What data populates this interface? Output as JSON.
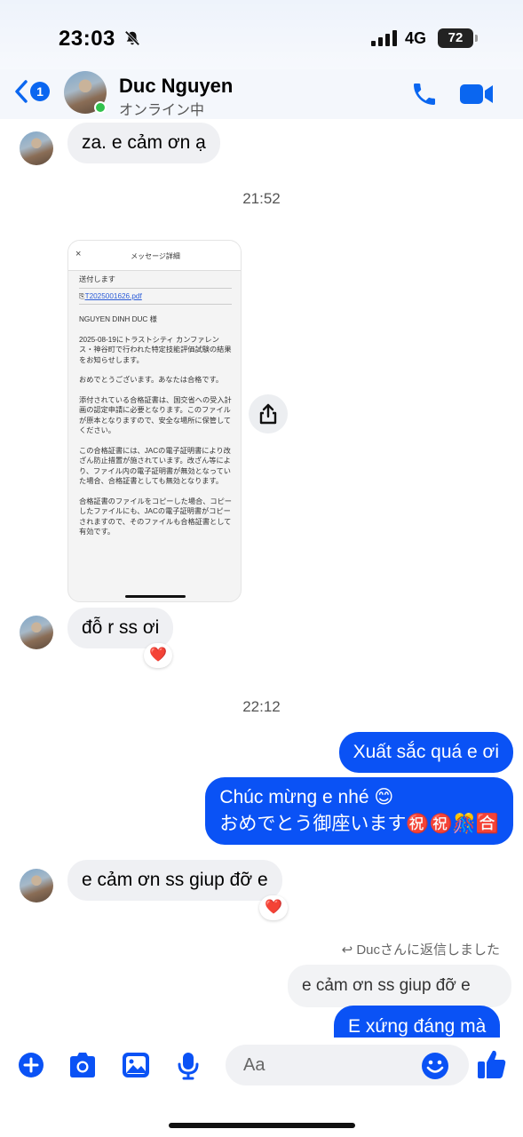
{
  "status_bar": {
    "time": "23:03",
    "network": "4G",
    "battery": "72"
  },
  "header": {
    "back_badge": "1",
    "contact_name": "Duc Nguyen",
    "contact_status": "オンライン中"
  },
  "messages": {
    "m1": "za. e cảm ơn ạ",
    "time1": "21:52",
    "document": {
      "close": "×",
      "title": "メッセージ詳細",
      "line1": "送付します",
      "link": "T2025001626.pdf",
      "addressee": "NGUYEN DINH DUC 様",
      "p1": "2025-08-19にトラストシティ カンファレンス・神谷町で行われた特定技能評価試験の結果をお知らせします。",
      "p2": "おめでとうございます。あなたは合格です。",
      "p3": "添付されている合格証書は、国交省への受入計画の認定申請に必要となります。このファイルが原本となりますので、安全な場所に保管してください。",
      "p4": "この合格証書には、JACの電子証明書により改ざん防止措置が施されています。改ざん等により、ファイル内の電子証明書が無効となっていた場合、合格証書としても無効となります。",
      "p5": "合格証書のファイルをコピーした場合、コピーしたファイルにも、JACの電子証明書がコピーされますので、そのファイルも合格証書として有効です。"
    },
    "m2": "đỗ r ss ơi",
    "m2_reaction": "❤️",
    "time2": "22:12",
    "m3": "Xuất sắc quá e ơi",
    "m4_line1": "Chúc mừng e nhé 😊",
    "m4_line2": "おめでとう御座います㊗️㊗️🎊🈴",
    "m5": "e cảm ơn ss giup đỡ e",
    "m5_reaction": "❤️",
    "reply_note": "Ducさんに返信しました",
    "quoted": "e cảm ơn ss giup đỡ e",
    "m6": "E xứng đáng mà"
  },
  "composer": {
    "placeholder": "Aa"
  },
  "colors": {
    "accent": "#0a52f5",
    "incoming": "#eff0f3",
    "online": "#31c24d"
  }
}
